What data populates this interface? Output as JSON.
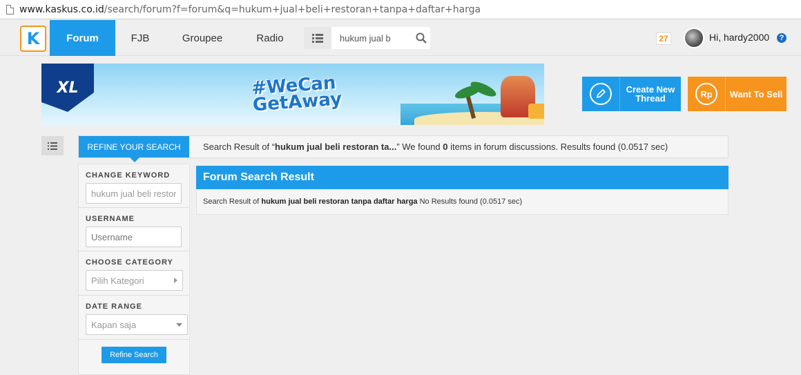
{
  "browser": {
    "url_host": "www.kaskus.co.id",
    "url_path": "/search/forum?f=forum&q=hukum+jual+beli+restoran+tanpa+daftar+harga"
  },
  "navbar": {
    "logo_text": "K",
    "items": [
      {
        "label": "Forum",
        "active": true
      },
      {
        "label": "FJB",
        "active": false
      },
      {
        "label": "Groupee",
        "active": false
      },
      {
        "label": "Radio",
        "active": false
      }
    ],
    "search_value": "hukum jual b",
    "notification_count": "27",
    "greeting": "Hi, hardy2000",
    "help_icon": "?"
  },
  "banner": {
    "brand": "XL",
    "tagline_line1": "#WeCan",
    "tagline_line2": "GetAway"
  },
  "actions": {
    "create_thread_label_1": "Create New",
    "create_thread_label_2": "Thread",
    "want_to_sell_label": "Want To Sell",
    "sell_icon_text": "Rp"
  },
  "refine": {
    "tab_label": "REFINE YOUR SEARCH",
    "summary_prefix": "Search Result of “",
    "summary_query": "hukum jual beli restoran ta...",
    "summary_mid": "” We found ",
    "summary_count": "0",
    "summary_suffix": " items in forum discussions. Results found (0.0517 sec)"
  },
  "sidebar": {
    "keyword_label": "CHANGE KEYWORD",
    "keyword_value": "hukum jual beli restoran tanpa daftar harga",
    "username_label": "USERNAME",
    "username_placeholder": "Username",
    "category_label": "CHOOSE CATEGORY",
    "category_value": "Pilih Kategori",
    "date_label": "DATE RANGE",
    "date_value": "Kapan saja",
    "refine_button": "Refine Search"
  },
  "results": {
    "title": "Forum Search Result",
    "prefix": "Search Result of ",
    "query": "hukum jual beli restoran tanpa daftar harga",
    "suffix": " No Results found (0.0517 sec)"
  },
  "colors": {
    "primary": "#1e9be8",
    "accent": "#f7941d"
  },
  "icons": [
    "list-icon",
    "search-icon",
    "pencil-icon",
    "help-icon",
    "chevron-right-icon",
    "chevron-down-icon"
  ]
}
